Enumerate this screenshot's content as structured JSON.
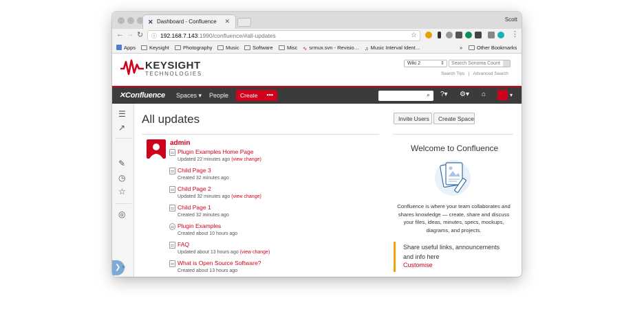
{
  "browser": {
    "tab_title": "Dashboard - Confluence",
    "user": "Scott",
    "url_host": "192.168.7.143",
    "url_rest": ":1990/confluence/#all-updates",
    "bookmarks": [
      "Apps",
      "Keysight",
      "Photography",
      "Music",
      "Software",
      "Misc",
      "srmux.svn - Revisio…",
      "Music Interval Ident…"
    ],
    "other_bookmarks": "Other Bookmarks"
  },
  "header": {
    "logo_title": "KEYSIGHT",
    "logo_subtitle": "TECHNOLOGIES",
    "wiki_select": "Wiki 2",
    "search_placeholder": "Search Sonoma Count",
    "search_tips": "Search Tips",
    "search_sep": "|",
    "advanced_search": "Advanced Search"
  },
  "nav": {
    "logo": "Confluence",
    "spaces": "Spaces ▾",
    "people": "People",
    "create": "Create",
    "more": "•••"
  },
  "main": {
    "title": "All updates",
    "author": "admin",
    "updates": [
      {
        "title": "Plugin Examples Home Page",
        "meta": "Updated 22 minutes ago",
        "view_change": "(view change)"
      },
      {
        "title": "Child Page 3",
        "meta": "Created 32 minutes ago",
        "view_change": ""
      },
      {
        "title": "Child Page 2",
        "meta": "Updated 32 minutes ago",
        "view_change": "(view change)"
      },
      {
        "title": "Child Page 1",
        "meta": "Created 32 minutes ago",
        "view_change": ""
      },
      {
        "title": "Plugin Examples",
        "meta": "Created about 10 hours ago",
        "view_change": ""
      },
      {
        "title": "FAQ",
        "meta": "Updated about 13 hours ago",
        "view_change": "(view change)"
      },
      {
        "title": "What is Open Source Software?",
        "meta": "Created about 13 hours ago",
        "view_change": ""
      }
    ]
  },
  "side": {
    "invite_users": "Invite Users",
    "create_space": "Create Space",
    "welcome_title": "Welcome to Confluence",
    "welcome_text": "Confluence is where your team collaborates and shares knowledge — create, share and discuss your files, ideas, minutes, specs, mockups, diagrams, and projects.",
    "callout_text": "Share useful links, announcements and info here",
    "customise": "Customise"
  },
  "colors": {
    "brand_red": "#d0021b",
    "nav_dark": "#3b3b3b",
    "callout_orange": "#f0a30a"
  }
}
